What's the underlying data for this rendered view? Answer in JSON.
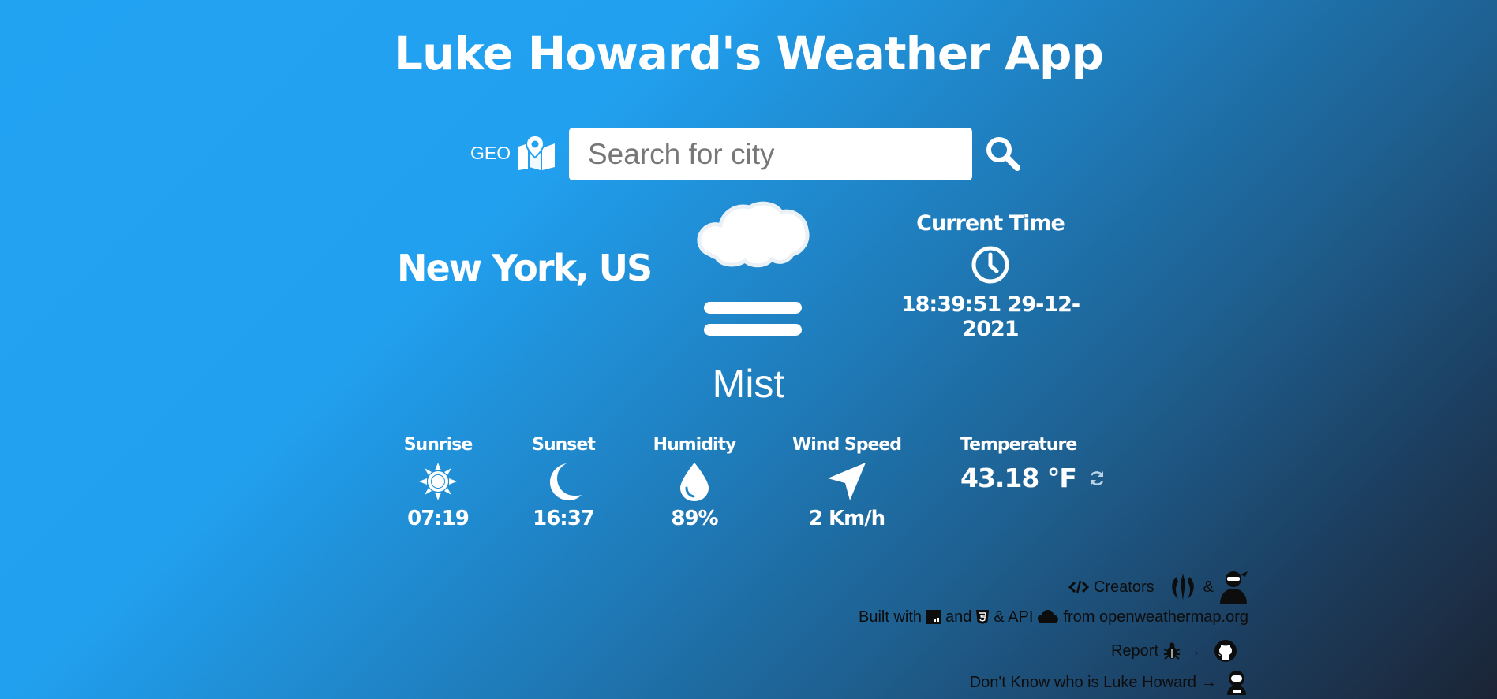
{
  "app": {
    "title": "Luke Howard's Weather App"
  },
  "search": {
    "geo_label": "GEO",
    "placeholder": "Search for city",
    "value": ""
  },
  "location": {
    "city": "New York, US"
  },
  "current": {
    "condition": "Mist",
    "icon": "mist-icon",
    "time_label": "Current Time",
    "time_value": "18:39:51 29-12-2021"
  },
  "stats": {
    "sunrise": {
      "label": "Sunrise",
      "value": "07:19",
      "icon": "sun-icon"
    },
    "sunset": {
      "label": "Sunset",
      "value": "16:37",
      "icon": "moon-icon"
    },
    "humidity": {
      "label": "Humidity",
      "value": "89%",
      "icon": "droplet-icon"
    },
    "wind": {
      "label": "Wind Speed",
      "value": "2 Km/h",
      "icon": "location-arrow-icon"
    },
    "temperature": {
      "label": "Temperature",
      "value": "43.18 °F",
      "icon": "refresh-icon"
    }
  },
  "footer": {
    "creators_label": "Creators",
    "amp": "&",
    "built_with": "Built with",
    "and": "and",
    "api_prefix": "& API",
    "api_source": "from openweathermap.org",
    "report": "Report",
    "arrow": "→",
    "dont_know": "Don't Know who is Luke Howard"
  },
  "colors": {
    "gradient_start": "#22a3f2",
    "gradient_end": "#1b2435",
    "text": "#ffffff",
    "footer_text": "#0d0d0d"
  }
}
